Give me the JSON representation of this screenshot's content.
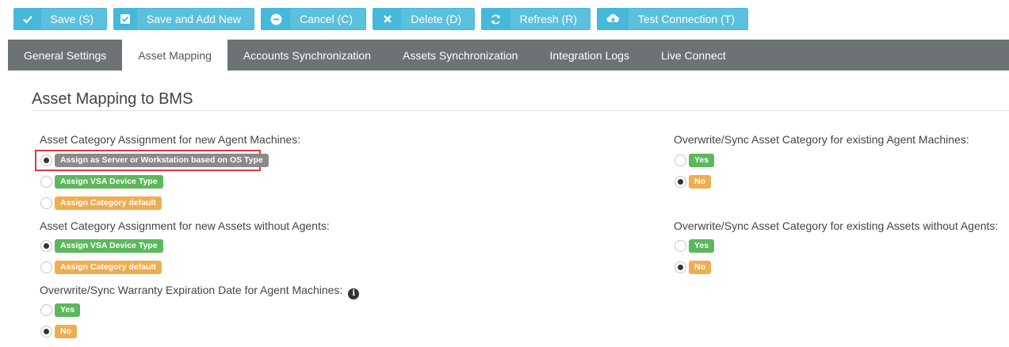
{
  "toolbar": {
    "buttons": [
      {
        "label": "Save (S)",
        "icon": "check-icon"
      },
      {
        "label": "Save and Add New",
        "icon": "checkbox-icon"
      },
      {
        "label": "Cancel (C)",
        "icon": "minus-circle-icon"
      },
      {
        "label": "Delete (D)",
        "icon": "x-icon"
      },
      {
        "label": "Refresh (R)",
        "icon": "refresh-icon"
      },
      {
        "label": "Test Connection (T)",
        "icon": "cloud-upload-icon"
      }
    ]
  },
  "tabs": [
    {
      "label": "General Settings",
      "active": false
    },
    {
      "label": "Asset Mapping",
      "active": true
    },
    {
      "label": "Accounts Synchronization",
      "active": false
    },
    {
      "label": "Assets Synchronization",
      "active": false
    },
    {
      "label": "Integration Logs",
      "active": false
    },
    {
      "label": "Live Connect",
      "active": false
    }
  ],
  "section_title": "Asset Mapping to BMS",
  "left": {
    "agent_machines": {
      "label": "Asset Category Assignment for new Agent Machines:",
      "options": [
        {
          "text": "Assign as Server or Workstation based on OS Type",
          "selected": true
        },
        {
          "text": "Assign VSA Device Type",
          "selected": false
        },
        {
          "text": "Assign Category default",
          "selected": false
        }
      ]
    },
    "assets_without_agents": {
      "label": "Asset Category Assignment for new Assets without Agents:",
      "options": [
        {
          "text": "Assign VSA Device Type",
          "selected": true
        },
        {
          "text": "Assign Category default",
          "selected": false
        }
      ]
    },
    "warranty": {
      "label": "Overwrite/Sync Warranty Expiration Date for Agent Machines:",
      "options": [
        {
          "text": "Yes",
          "selected": false
        },
        {
          "text": "No",
          "selected": true
        }
      ]
    }
  },
  "right": {
    "existing_agent_machines": {
      "label": "Overwrite/Sync Asset Category for existing Agent Machines:",
      "options": [
        {
          "text": "Yes",
          "selected": false
        },
        {
          "text": "No",
          "selected": true
        }
      ]
    },
    "existing_assets_without_agents": {
      "label": "Overwrite/Sync Asset Category for existing Assets without Agents:",
      "options": [
        {
          "text": "Yes",
          "selected": false
        },
        {
          "text": "No",
          "selected": true
        }
      ]
    }
  },
  "colors": {
    "toolbar_button": "#5bc0de",
    "tab_bar": "#6d7274",
    "badge_green": "#5cb85c",
    "badge_orange": "#f0ad4e",
    "badge_grey": "#8a8a8a",
    "highlight_border": "#e03a3e"
  }
}
